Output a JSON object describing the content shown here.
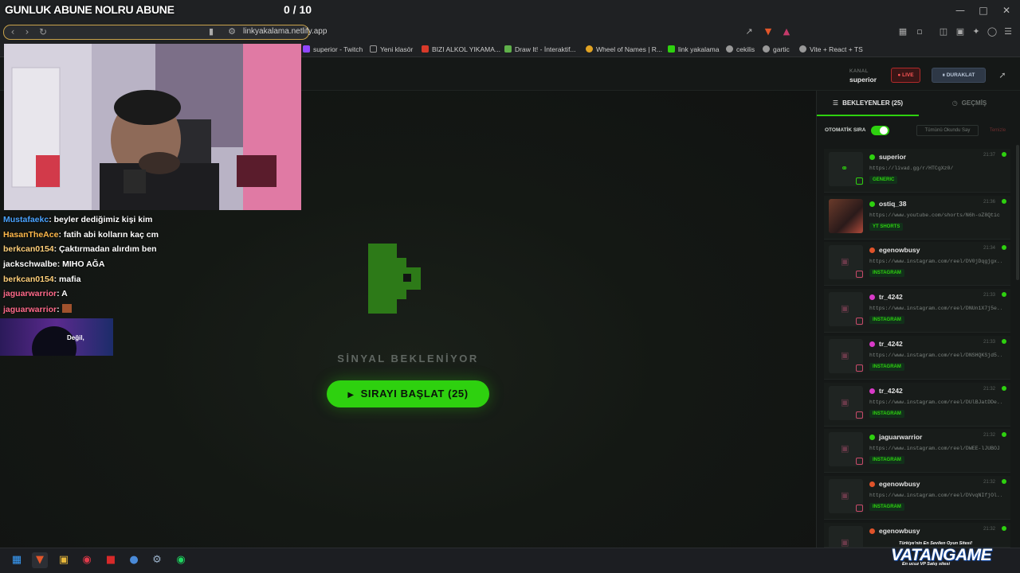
{
  "overlay": {
    "title": "GUNLUK ABUNE NOLRU ABUNE",
    "counter": "0 / 10"
  },
  "browser": {
    "url": "linkyakalama.netlify.app",
    "bookmarks": [
      {
        "label": "superior - Twitch",
        "color": "#9146ff"
      },
      {
        "label": "Yeni klasör",
        "color": "#888888"
      },
      {
        "label": "BIZI ALKOL YIKAMA...",
        "color": "#d83a2a"
      },
      {
        "label": "Draw It! - İnteraktif...",
        "color": "#5fb04a"
      },
      {
        "label": "Wheel of Names | R...",
        "color": "#e2a323"
      },
      {
        "label": "link yakalama",
        "color": "#2ed10f"
      },
      {
        "label": "cekilis",
        "color": "#aaaaaa"
      },
      {
        "label": "gartic",
        "color": "#aaaaaa"
      },
      {
        "label": "Vite + React + TS",
        "color": "#aaaaaa"
      }
    ]
  },
  "header": {
    "kanal_label": "KANAL",
    "kanal_name": "superior",
    "live_label": "● LIVE",
    "pause_label": "⏸ DURAKLAT"
  },
  "main": {
    "status": "SİNYAL BEKLENİYOR",
    "start_label": "SIRAYI BAŞLAT (25)"
  },
  "chat": [
    {
      "user": "Mustafaekc",
      "user_color": "#4aa3ff",
      "text": " beyler dediğimiz kişi kim"
    },
    {
      "user": "HasanTheAce",
      "user_color": "#ffb84a",
      "text": " fatih abi kolların kaç cm"
    },
    {
      "user": "berkcan0154",
      "user_color": "#ffd07a",
      "text": " Çaktırmadan alırdım ben"
    },
    {
      "user": "jackschwalbe",
      "user_color": "#ffffff",
      "text": " MIHO AĞA"
    },
    {
      "user": "berkcan0154",
      "user_color": "#ffd07a",
      "text": " mafia"
    },
    {
      "user": "jaguarwarrior",
      "user_color": "#ff6a8a",
      "text": " A"
    },
    {
      "user": "jaguarwarrior",
      "user_color": "#ff6a8a",
      "text": ""
    }
  ],
  "chat_banner": "Değil,",
  "sidebar": {
    "tab_waiting": "BEKLEYENLER (25)",
    "tab_history": "GEÇMİŞ",
    "auto_label": "OTOMATİK SIRA",
    "mark_read": "Tümünü Okundu Say",
    "clear": "Temizle",
    "cards": [
      {
        "user": "superior",
        "time": "21:37",
        "url": "https://livad.gg/r/HTCgXz0/",
        "tag": "GENERIC",
        "dot": "#2ed10f"
      },
      {
        "user": "ostiq_38",
        "time": "21:36",
        "url": "https://www.youtube.com/shorts/N6h-oZ8Qtic",
        "tag": "YT SHORTS",
        "dot": "#2ed10f"
      },
      {
        "user": "egenowbusy",
        "time": "21:34",
        "url": "https://www.instagram.com/reel/DV0jDqgjgx...",
        "tag": "INSTAGRAM",
        "dot": "#e0532a"
      },
      {
        "user": "tr_4242",
        "time": "21:33",
        "url": "https://www.instagram.com/reel/DNUn1X7j5e...",
        "tag": "INSTAGRAM",
        "dot": "#d83ac8"
      },
      {
        "user": "tr_4242",
        "time": "21:33",
        "url": "https://www.instagram.com/reel/DNSHQKSjd5...",
        "tag": "INSTAGRAM",
        "dot": "#d83ac8"
      },
      {
        "user": "tr_4242",
        "time": "21:32",
        "url": "https://www.instagram.com/reel/DUlBJatDDe...",
        "tag": "INSTAGRAM",
        "dot": "#d83ac8"
      },
      {
        "user": "jaguarwarrior",
        "time": "21:32",
        "url": "https://www.instagram.com/reel/DWEE-lJUBOJ",
        "tag": "INSTAGRAM",
        "dot": "#2ed10f"
      },
      {
        "user": "egenowbusy",
        "time": "21:32",
        "url": "https://www.instagram.com/reel/DVvqNIfjOl...",
        "tag": "INSTAGRAM",
        "dot": "#e0532a"
      },
      {
        "user": "egenowbusy",
        "time": "21:32",
        "url": "",
        "tag": "",
        "dot": "#e0532a"
      }
    ]
  },
  "promo": {
    "top": "Türkiye'nin En Sevilen Oyun Sitesi!",
    "logo": "VATANGAME",
    "bottom": "En ucuz VP Satış sitesi"
  },
  "colors": {
    "accent": "#2ed10f",
    "background": "#121514",
    "live": "#ff5555"
  }
}
